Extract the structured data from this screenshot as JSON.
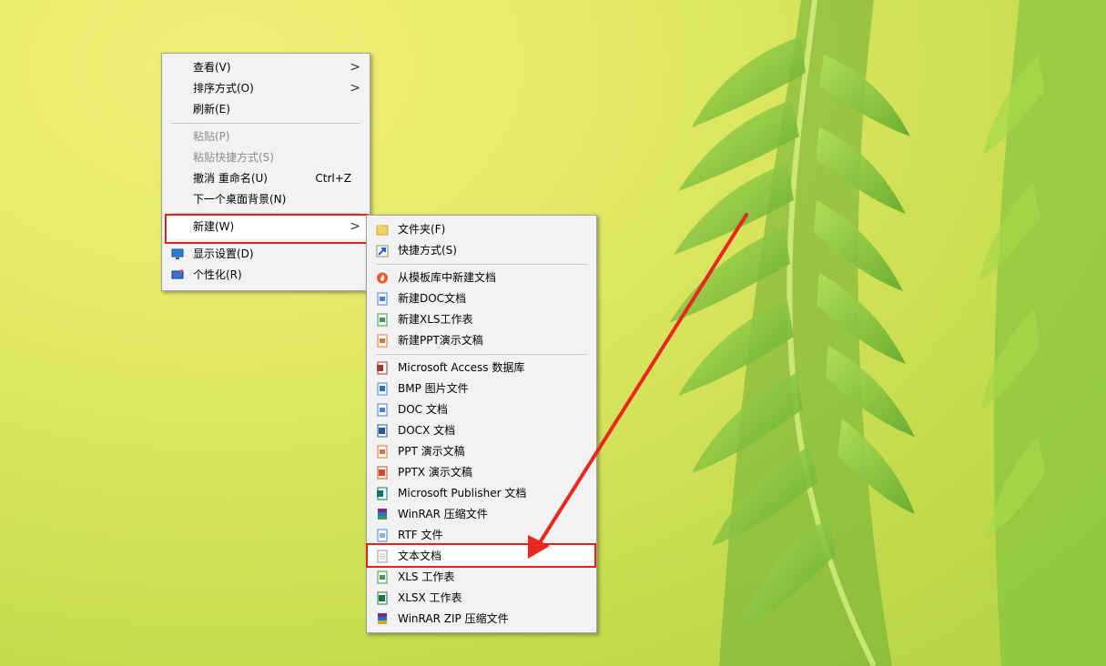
{
  "context_menu": {
    "items": [
      {
        "label": "查看(V)"
      },
      {
        "label": "排序方式(O)"
      },
      {
        "label": "刷新(E)"
      },
      {
        "label": "粘贴(P)"
      },
      {
        "label": "粘贴快捷方式(S)"
      },
      {
        "label": "撤消 重命名(U)",
        "shortcut": "Ctrl+Z"
      },
      {
        "label": "下一个桌面背景(N)"
      },
      {
        "label": "新建(W)"
      },
      {
        "label": "显示设置(D)",
        "icon": "display-icon"
      },
      {
        "label": "个性化(R)",
        "icon": "personalize-icon"
      }
    ],
    "chevron": ">"
  },
  "submenu": {
    "items": [
      {
        "label": "文件夹(F)",
        "icon": "folder-icon"
      },
      {
        "label": "快捷方式(S)",
        "icon": "shortcut-icon"
      },
      {
        "label": "从模板库中新建文档",
        "icon": "wps-template-icon"
      },
      {
        "label": "新建DOC文档",
        "icon": "doc-icon"
      },
      {
        "label": "新建XLS工作表",
        "icon": "xls-icon"
      },
      {
        "label": "新建PPT演示文稿",
        "icon": "ppt-icon"
      },
      {
        "label": "Microsoft Access 数据库",
        "icon": "access-icon"
      },
      {
        "label": "BMP 图片文件",
        "icon": "bmp-icon"
      },
      {
        "label": "DOC 文档",
        "icon": "doc-icon"
      },
      {
        "label": "DOCX 文档",
        "icon": "docx-icon"
      },
      {
        "label": "PPT 演示文稿",
        "icon": "ppt-icon"
      },
      {
        "label": "PPTX 演示文稿",
        "icon": "pptx-icon"
      },
      {
        "label": "Microsoft Publisher 文档",
        "icon": "publisher-icon"
      },
      {
        "label": "WinRAR 压缩文件",
        "icon": "winrar-icon"
      },
      {
        "label": "RTF 文件",
        "icon": "rtf-icon"
      },
      {
        "label": "文本文档",
        "icon": "text-document-icon"
      },
      {
        "label": "XLS 工作表",
        "icon": "xls-icon"
      },
      {
        "label": "XLSX 工作表",
        "icon": "xlsx-icon"
      },
      {
        "label": "WinRAR ZIP 压缩文件",
        "icon": "winrar-zip-icon"
      }
    ]
  },
  "colors": {
    "highlight": "#e0241d",
    "menu_bg": "#f2f2f2",
    "leaf_green": "#8cc63f"
  }
}
